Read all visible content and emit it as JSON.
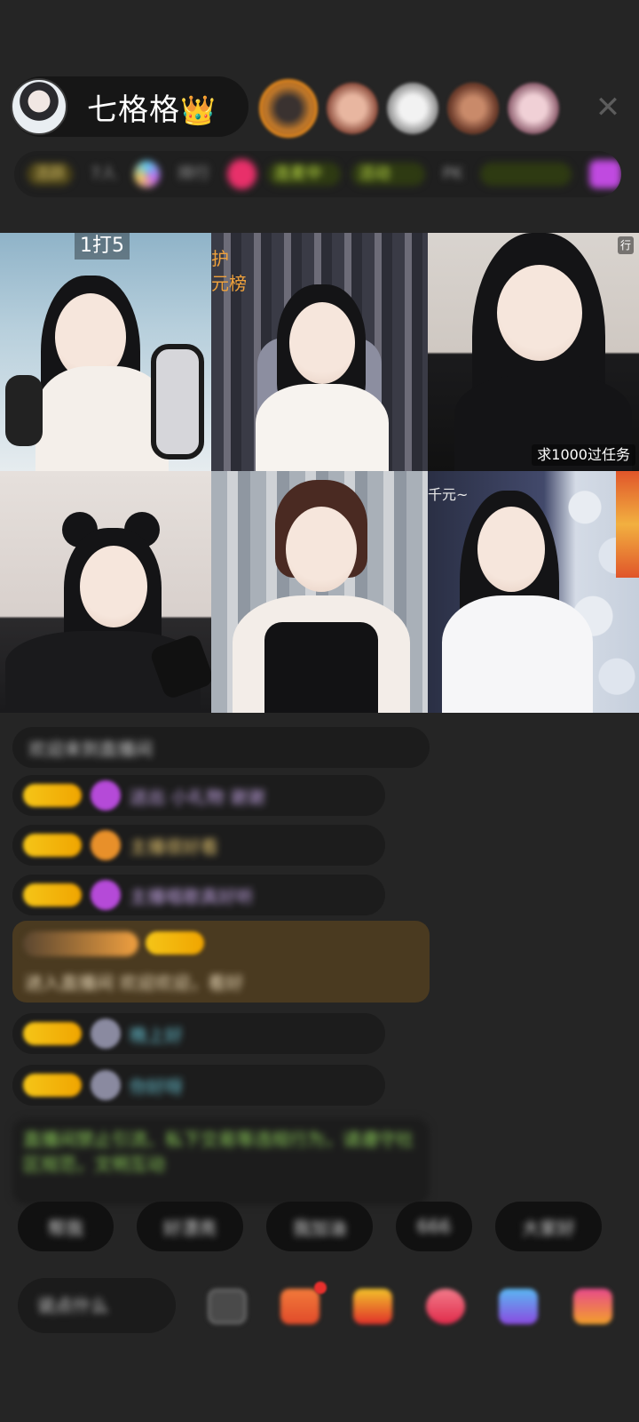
{
  "host": {
    "name": "七格格",
    "crown_icon": "👑"
  },
  "viewers": [
    "viewer-avatar-1",
    "viewer-avatar-2",
    "viewer-avatar-3",
    "viewer-avatar-4",
    "viewer-avatar-5"
  ],
  "close_icon": "✕",
  "status_row": {
    "chips": [
      "活跃",
      "7人",
      "排行",
      "连麦中",
      "活动",
      "PK"
    ]
  },
  "video_grid": {
    "tiles": [
      {
        "label": "1打5"
      },
      {
        "label_top": "护",
        "label_bottom": "元榜"
      },
      {
        "corner_tag": "行",
        "caption": "求1000过任务"
      },
      {
        "label": ""
      },
      {
        "label": ""
      },
      {
        "label_top": "千元~"
      }
    ]
  },
  "chat": {
    "messages": [
      "欢迎来到直播间",
      "送出 小礼物 谢谢",
      "主播很好看",
      "主播唱歌真好听",
      "进入直播间 欢迎欢迎，看好",
      "晚上好",
      "你好呀"
    ],
    "notice": "直播间禁止引流、私下交易等违规行为，请遵守社区规范，文明互动"
  },
  "colors": {
    "background": "#252525",
    "badge_gold": "#f5c518",
    "crown": "#f6c21c",
    "notice_green": "#8fd25a"
  }
}
